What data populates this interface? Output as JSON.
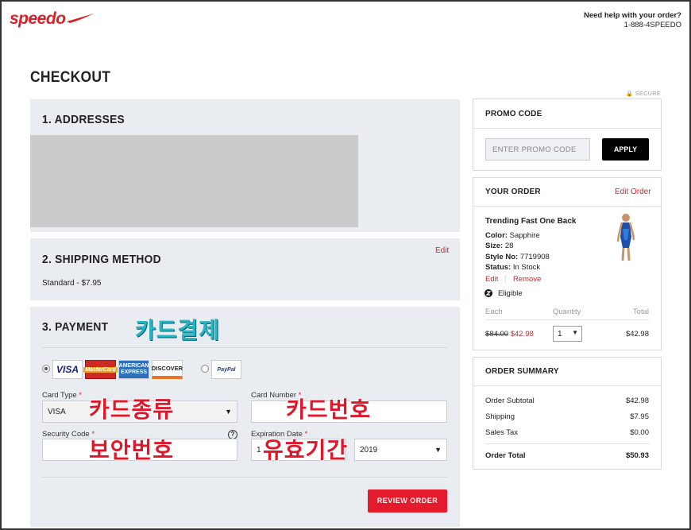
{
  "header": {
    "logo": "speedo",
    "help_text": "Need help with your order?",
    "phone": "1-888-4SPEEDO"
  },
  "page": {
    "title": "CHECKOUT",
    "secure_label": "SECURE"
  },
  "addresses": {
    "title": "1. ADDRESSES"
  },
  "shipping": {
    "title": "2. SHIPPING METHOD",
    "edit": "Edit",
    "value": "Standard   - $7.95"
  },
  "payment": {
    "title": "3. PAYMENT",
    "card_logos": [
      "VISA",
      "MasterCard",
      "AMERICAN EXPRESS",
      "DISCOVER"
    ],
    "paypal_logo": "PayPal",
    "card_type_label": "Card Type",
    "card_type_value": "VISA",
    "card_number_label": "Card Number",
    "security_code_label": "Security Code",
    "expiration_label": "Expiration Date",
    "exp_month_value": "1",
    "exp_year_value": "2019",
    "required_mark": "*",
    "help_glyph": "?",
    "review_button": "REVIEW ORDER"
  },
  "annotations": {
    "card_payment": "카드결제",
    "card_type": "카드종류",
    "card_number": "카드번호",
    "security_code": "보안번호",
    "expiration": "유효기간"
  },
  "promo": {
    "title": "PROMO CODE",
    "placeholder": "ENTER PROMO CODE",
    "apply": "APPLY"
  },
  "your_order": {
    "title": "YOUR ORDER",
    "edit": "Edit Order",
    "item": {
      "name": "Trending Fast One Back",
      "color_label": "Color:",
      "color": "Sapphire",
      "size_label": "Size:",
      "size": "28",
      "style_label": "Style No:",
      "style": "7719908",
      "status_label": "Status:",
      "status": "In Stock",
      "edit": "Edit",
      "remove": "Remove",
      "eligible": "Eligible"
    },
    "columns": {
      "each": "Each",
      "quantity": "Quantity",
      "total": "Total"
    },
    "price_original": "$84.00",
    "price_sale": "$42.98",
    "quantity": "1",
    "line_total": "$42.98"
  },
  "summary": {
    "title": "ORDER SUMMARY",
    "rows": [
      {
        "label": "Order Subtotal",
        "value": "$42.98"
      },
      {
        "label": "Shipping",
        "value": "$7.95"
      },
      {
        "label": "Sales Tax",
        "value": "$0.00"
      }
    ],
    "total_label": "Order Total",
    "total_value": "$50.93"
  },
  "colors": {
    "brand_red": "#d8202a",
    "panel_bg": "#e9ecf1",
    "annotation_red": "#e0162b",
    "annotation_teal": "#27b5c4"
  }
}
